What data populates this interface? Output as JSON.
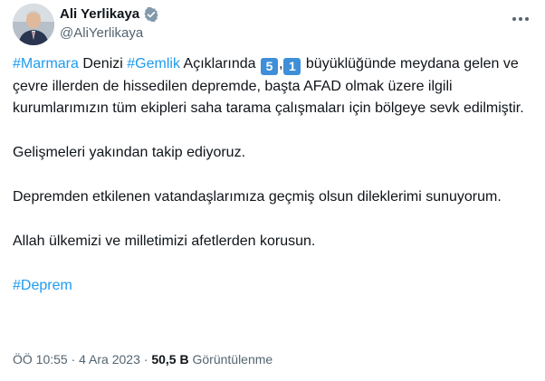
{
  "user": {
    "display_name": "Ali Yerlikaya",
    "handle": "@AliYerlikaya",
    "verified_icon": "verified-badge-icon",
    "more_icon": "more-options-icon"
  },
  "tweet": {
    "line1": {
      "tag1": "#Marmara",
      "text1": " Denizi ",
      "tag2": "#Gemlik",
      "text2": " Açıklarında ",
      "keycap1": "5",
      "comma": ",",
      "keycap2": "1",
      "text3": " büyüklüğünde meydana gelen ve çevre illerden de hissedilen depremde, başta AFAD olmak üzere ilgili kurumlarımızın tüm ekipleri saha tarama çalışmaları için bölgeye sevk edilmiştir."
    },
    "para2": "Gelişmeleri yakından takip ediyoruz.",
    "para3": "Depremden etkilenen vatandaşlarımıza geçmiş olsun dileklerimi sunuyorum.",
    "para4": "Allah ülkemizi ve milletimizi afetlerden korusun.",
    "hashtag_final": "#Deprem"
  },
  "meta": {
    "time": "ÖÖ 10:55",
    "sep1": " · ",
    "date": "4 Ara 2023",
    "sep2": " · ",
    "views_count": "50,5 B",
    "views_label": " Görüntülenme"
  },
  "colors": {
    "link": "#1d9bf0",
    "text": "#0f1419",
    "secondary": "#536471",
    "keycap": "#3e8fd8"
  }
}
